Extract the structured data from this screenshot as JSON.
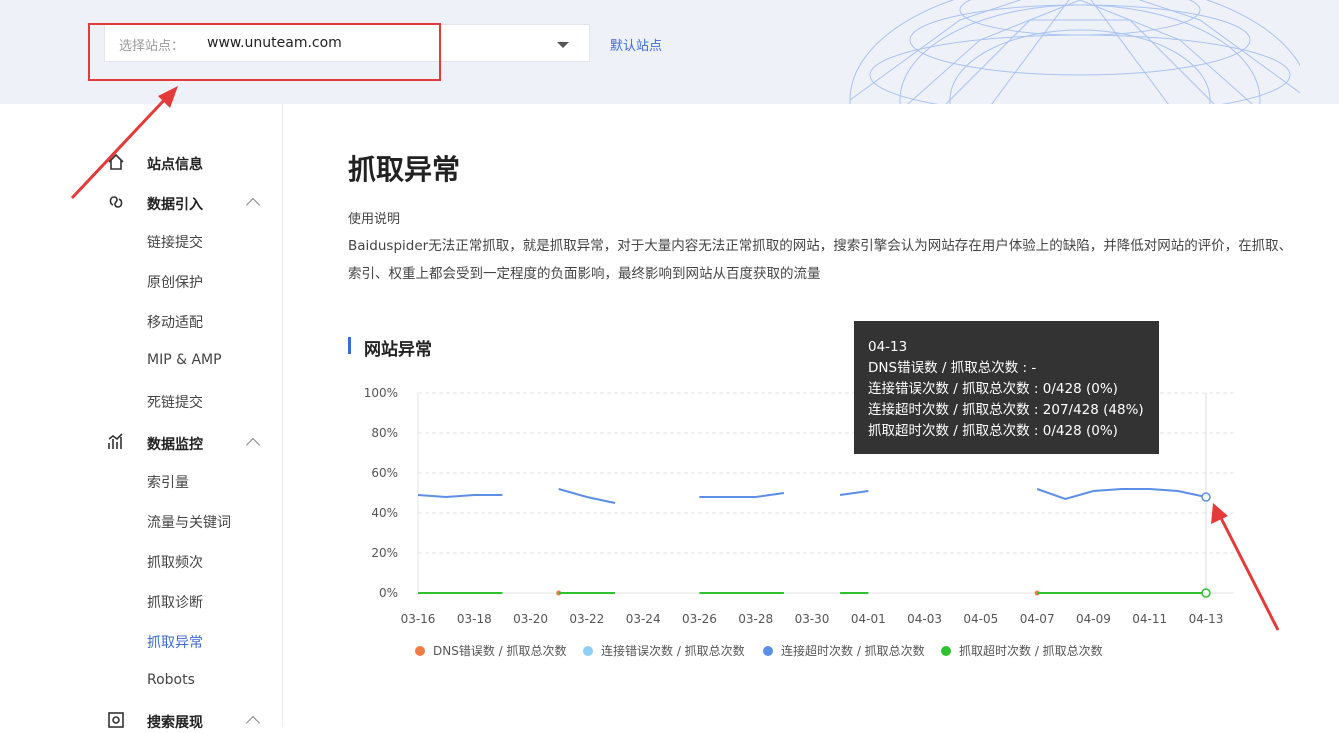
{
  "site_selector": {
    "label": "选择站点：",
    "value": "www.unuteam.com",
    "default_link": "默认站点"
  },
  "sidebar": {
    "groups": [
      {
        "label": "站点信息",
        "icon": "home-icon",
        "items": []
      },
      {
        "label": "数据引入",
        "icon": "link-icon",
        "expanded": true,
        "items": [
          "链接提交",
          "原创保护",
          "移动适配",
          "MIP & AMP",
          "死链提交"
        ]
      },
      {
        "label": "数据监控",
        "icon": "monitor-icon",
        "expanded": true,
        "items": [
          "索引量",
          "流量与关键词",
          "抓取频次",
          "抓取诊断",
          "抓取异常",
          "Robots"
        ]
      },
      {
        "label": "搜索展现",
        "icon": "search-display-icon",
        "expanded": true,
        "items": []
      }
    ],
    "active_item": "抓取异常"
  },
  "main": {
    "title": "抓取异常",
    "usage_label": "使用说明",
    "description": "Baiduspider无法正常抓取，就是抓取异常，对于大量内容无法正常抓取的网站，搜索引擎会认为网站存在用户体验上的缺陷，并降低对网站的评价，在抓取、索引、权重上都会受到一定程度的负面影响，最终影响到网站从百度获取的流量",
    "section_title": "网站异常"
  },
  "tooltip": {
    "date": "04-13",
    "lines": [
      "DNS错误数 / 抓取总次数 : -",
      "连接错误次数 / 抓取总次数 : 0/428 (0%)",
      "连接超时次数 / 抓取总次数 : 207/428 (48%)",
      "抓取超时次数 / 抓取总次数 : 0/428 (0%)"
    ]
  },
  "colors": {
    "accent": "#3c6ad6",
    "dns": "#f07b47",
    "conn_err": "#8ecff5",
    "conn_timeout": "#5b8ee6",
    "fetch_timeout": "#2ec22e",
    "annotation": "#e53a3a"
  },
  "chart_data": {
    "type": "line",
    "x": [
      "03-16",
      "03-17",
      "03-18",
      "03-19",
      "03-20",
      "03-21",
      "03-22",
      "03-23",
      "03-24",
      "03-25",
      "03-26",
      "03-27",
      "03-28",
      "03-29",
      "03-30",
      "03-31",
      "04-01",
      "04-02",
      "04-03",
      "04-04",
      "04-05",
      "04-06",
      "04-07",
      "04-08",
      "04-09",
      "04-10",
      "04-11",
      "04-12",
      "04-13"
    ],
    "x_ticks": [
      "03-16",
      "03-18",
      "03-20",
      "03-22",
      "03-24",
      "03-26",
      "03-28",
      "03-30",
      "04-01",
      "04-03",
      "04-05",
      "04-07",
      "04-09",
      "04-11",
      "04-13"
    ],
    "y_ticks": [
      "0%",
      "20%",
      "40%",
      "60%",
      "80%",
      "100%"
    ],
    "ylim": [
      0,
      100
    ],
    "grid": true,
    "legend_position": "bottom",
    "series": [
      {
        "name": "DNS错误数 / 抓取总次数",
        "color": "#f07b47",
        "values": [
          null,
          null,
          null,
          null,
          null,
          0,
          null,
          null,
          null,
          null,
          null,
          null,
          null,
          null,
          null,
          null,
          null,
          null,
          null,
          null,
          null,
          null,
          0,
          null,
          null,
          null,
          null,
          null,
          null
        ]
      },
      {
        "name": "连接错误次数 / 抓取总次数",
        "color": "#8ecff5",
        "values": [
          0,
          0,
          0,
          0,
          null,
          0,
          0,
          0,
          null,
          null,
          0,
          0,
          0,
          0,
          null,
          0,
          0,
          null,
          null,
          null,
          null,
          null,
          0,
          0,
          0,
          0,
          0,
          0,
          0
        ]
      },
      {
        "name": "连接超时次数 / 抓取总次数",
        "color": "#5b8ee6",
        "values": [
          49,
          48,
          49,
          49,
          null,
          52,
          48,
          45,
          null,
          null,
          48,
          48,
          48,
          50,
          null,
          49,
          51,
          null,
          null,
          null,
          null,
          null,
          52,
          47,
          51,
          52,
          52,
          51,
          48
        ]
      },
      {
        "name": "抓取超时次数 / 抓取总次数",
        "color": "#2ec22e",
        "values": [
          0,
          0,
          0,
          0,
          null,
          0,
          0,
          0,
          null,
          null,
          0,
          0,
          0,
          0,
          null,
          0,
          0,
          null,
          null,
          null,
          null,
          null,
          0,
          0,
          0,
          0,
          0,
          0,
          0
        ]
      }
    ],
    "highlight_index": 28
  }
}
